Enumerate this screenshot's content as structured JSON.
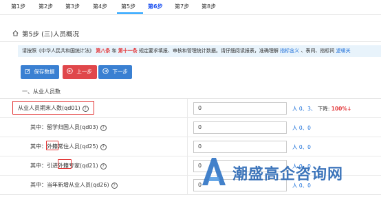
{
  "steps": [
    "第1步",
    "第2步",
    "第3步",
    "第4步",
    "第5步",
    "第6步",
    "第7步",
    "第8步"
  ],
  "active_step_index": 4,
  "page_title": "第5步 (三)人员概况",
  "notice": {
    "part1": "请按照《中华人民共和国统计法》",
    "red1": "第八条",
    "and": " 和 ",
    "red2": "第十一条",
    "part2": " 规定要求填报、审核和管理统计数据。请仔细阅读报表，准确理解",
    "link1": "指标含义",
    "part3": "、表间、指标间",
    "link2": "逻辑关"
  },
  "buttons": {
    "save": "保存数据",
    "prev": "上一步",
    "next": "下一步"
  },
  "section_title": "一、从业人员数",
  "rows": [
    {
      "label": "从业人员期末人数(qd01)",
      "value": "0",
      "stat_prefix": "人",
      "stat_values": "0、3、",
      "stat_drop": "下降:",
      "stat_pct": "100%↓"
    },
    {
      "label": "其中：留学归国人员(qd03)",
      "value": "0",
      "stat_prefix": "人",
      "stat_values": "0、0"
    },
    {
      "label": "其中：外籍常住人员(qd25)",
      "value": "0",
      "stat_prefix": "人",
      "stat_values": "0、0"
    },
    {
      "label": "其中：引进外籍专家(qd21)",
      "value": "0",
      "stat_prefix": "人",
      "stat_values": "0、0"
    },
    {
      "label": "其中：当年新增从业人员(qd26)",
      "value": "0",
      "stat_prefix": "人",
      "stat_values": "0、0"
    }
  ],
  "watermark": "潮盛高企咨询网",
  "colors": {
    "accent_blue": "#3a80d2",
    "danger_red": "#e0474b",
    "highlight_red": "#e23131",
    "notice_bg": "#e8f3fb"
  }
}
